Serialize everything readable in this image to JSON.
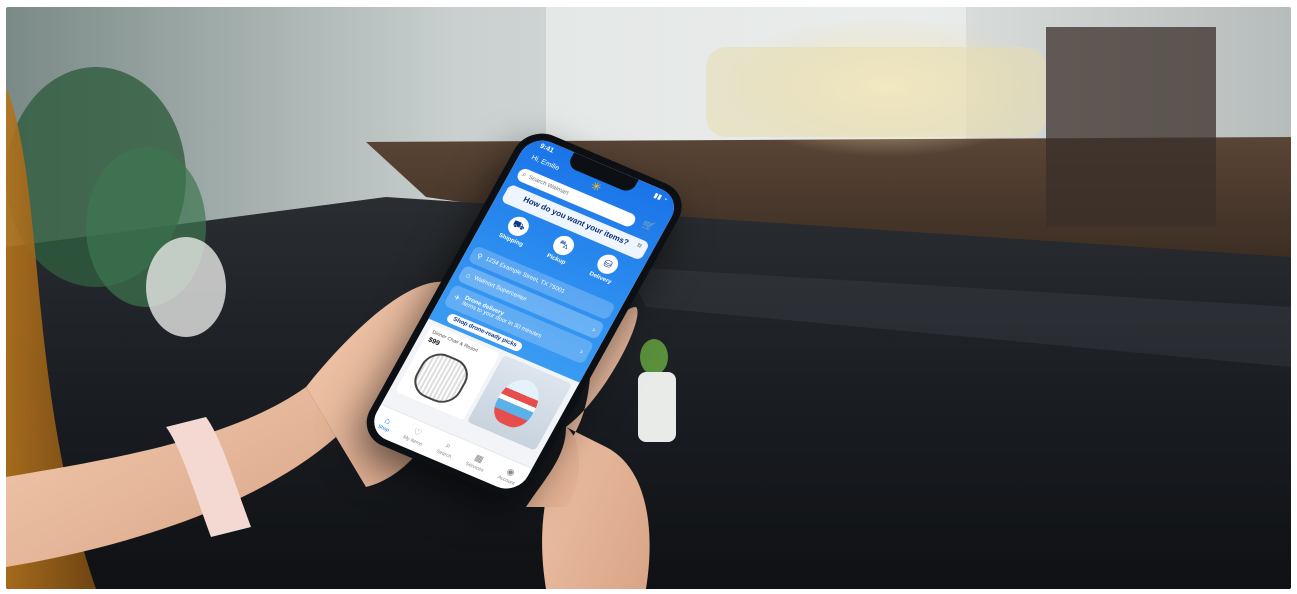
{
  "phone": {
    "status_time": "9:41",
    "greeting": "Hi, Emilie",
    "search_placeholder": "Search Walmart",
    "question": "How do you want your items?",
    "modes": [
      {
        "label": "Shipping",
        "icon": "truck-icon"
      },
      {
        "label": "Pickup",
        "icon": "car-icon"
      },
      {
        "label": "Delivery",
        "icon": "bag-icon"
      }
    ],
    "rows": {
      "address": "1234 Example Street, TX 75001",
      "store_title": "Walmart Supercenter",
      "store_address": "Sesuri Ave Hills Rd Birsny, TX 75001",
      "drone_title": "Drone delivery",
      "drone_sub": "Items to your door in 30 minutes"
    },
    "cta": "Shop drone-ready picks",
    "products": [
      {
        "caption": "Dinner Chair & Resort",
        "price": "$99"
      }
    ],
    "tabs": [
      {
        "label": "Shop",
        "icon": "home-icon",
        "active": true
      },
      {
        "label": "My Items",
        "icon": "heart-icon",
        "active": false
      },
      {
        "label": "Search",
        "icon": "search-icon",
        "active": false
      },
      {
        "label": "Services",
        "icon": "grid-icon",
        "active": false
      },
      {
        "label": "Account",
        "icon": "account-icon",
        "active": false
      }
    ]
  },
  "colors": {
    "accent": "#0071dc",
    "spark": "#ffc220",
    "header_blue": "#1a74e8"
  }
}
